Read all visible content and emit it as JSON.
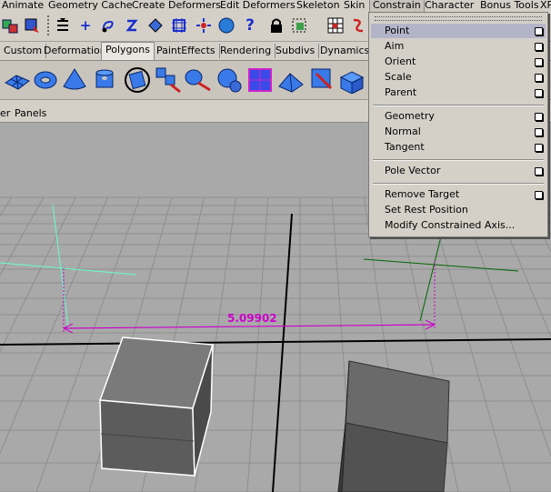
{
  "menubar": {
    "items": [
      "Animate",
      "Geometry Cache",
      "Create Deformers",
      "Edit Deformers",
      "Skeleton",
      "Skin",
      "Constrain",
      "Character",
      "Bonus Tools",
      "XP"
    ],
    "active": "Constrain"
  },
  "shelf_tabs": {
    "items": [
      "Custom",
      "Deformation",
      "Polygons",
      "PaintEffects",
      "Rendering",
      "Subdivs",
      "Dynamics"
    ],
    "active": "Polygons"
  },
  "panel_menu": {
    "items": [
      "er",
      "Panels"
    ]
  },
  "viewport": {
    "measurement_label": "5.09902",
    "colors": {
      "background": "#a9a9a9",
      "grid": "#8e8e8e",
      "axis": "#000000",
      "measure": "#cc00cc",
      "locator_left": "#66ffcc",
      "locator_right": "#006600"
    }
  },
  "constrain_menu": {
    "items": [
      {
        "label": "Point",
        "has_option": true,
        "highlighted": true
      },
      {
        "label": "Aim",
        "has_option": true
      },
      {
        "label": "Orient",
        "has_option": true
      },
      {
        "label": "Scale",
        "has_option": true
      },
      {
        "label": "Parent",
        "has_option": true
      },
      {
        "label": "Geometry",
        "has_option": true
      },
      {
        "label": "Normal",
        "has_option": true
      },
      {
        "label": "Tangent",
        "has_option": true
      },
      {
        "label": "Pole Vector",
        "has_option": true
      },
      {
        "label": "Remove Target",
        "has_option": true
      },
      {
        "label": "Set Rest Position",
        "has_option": false
      },
      {
        "label": "Modify Constrained Axis...",
        "has_option": false
      }
    ]
  },
  "toolbar_icons": [
    "select-by-hierarchy-icon",
    "select-by-object-icon",
    "snap-divider-icon",
    "snap-grid-icon",
    "snap-curve-icon",
    "snap-point-icon",
    "snap-view-plane-icon",
    "make-live-icon",
    "history-icon",
    "render-icon",
    "ipr-render-icon",
    "help-icon",
    "lock-icon",
    "select-highlight-icon",
    "curves-icon",
    "channel-box-icon",
    "attribute-editor-icon"
  ],
  "shelf_icons": [
    "poly-plane-icon",
    "poly-torus-icon",
    "poly-cone-icon",
    "poly-cylinder-icon",
    "poly-mesh-icon",
    "poly-combine-icon",
    "poly-separate-icon",
    "poly-extract-icon",
    "poly-smooth-icon",
    "poly-boolean-icon",
    "poly-mirror-icon",
    "poly-cube-subdiv-icon",
    "poly-extrude-icon",
    "poly-bevel-icon",
    "poly-wedge-icon"
  ]
}
